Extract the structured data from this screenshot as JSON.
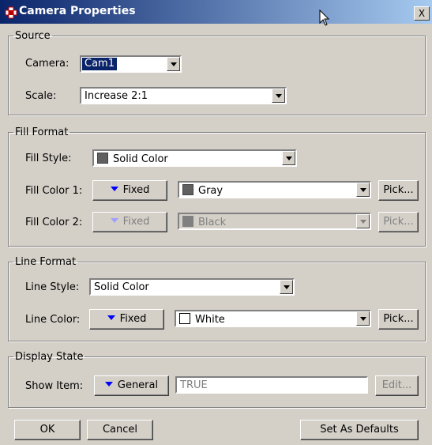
{
  "window": {
    "title": "Camera Properties",
    "close_label": "X"
  },
  "source": {
    "legend": "Source",
    "camera_label": "Camera:",
    "camera_value": "Cam1",
    "scale_label": "Scale:",
    "scale_value": "Increase 2:1"
  },
  "fill_format": {
    "legend": "Fill Format",
    "style_label": "Fill Style:",
    "style_value": "Solid Color",
    "style_color": "#606060",
    "color1_label": "Fill Color 1:",
    "color1_mode": "Fixed",
    "color1_value": "Gray",
    "color1_swatch": "#606060",
    "color1_pick": "Pick...",
    "color2_label": "Fill Color 2:",
    "color2_mode": "Fixed",
    "color2_value": "Black",
    "color2_swatch": "#808080",
    "color2_pick": "Pick..."
  },
  "line_format": {
    "legend": "Line Format",
    "style_label": "Line Style:",
    "style_value": "Solid Color",
    "color_label": "Line Color:",
    "color_mode": "Fixed",
    "color_value": "White",
    "color_swatch": "#ffffff",
    "color_pick": "Pick..."
  },
  "display_state": {
    "legend": "Display State",
    "show_label": "Show Item:",
    "show_mode": "General",
    "show_value": "TRUE",
    "edit_label": "Edit..."
  },
  "footer": {
    "ok": "OK",
    "cancel": "Cancel",
    "set_defaults": "Set As Defaults"
  }
}
